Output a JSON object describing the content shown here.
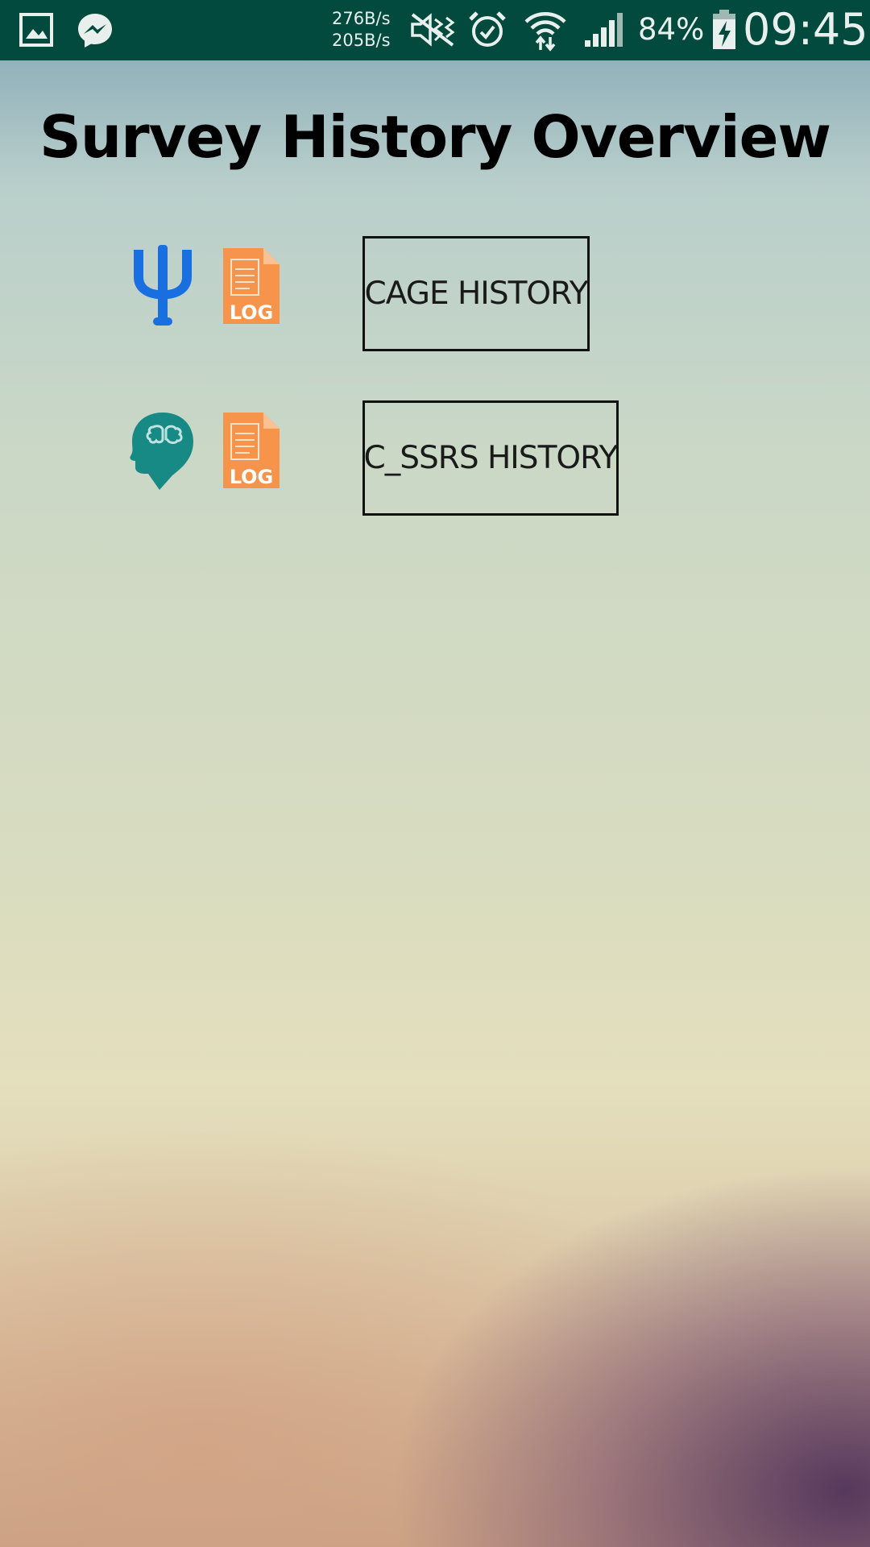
{
  "status_bar": {
    "net_up": "276B/s",
    "net_down": "205B/s",
    "battery_percent": "84%",
    "time": "09:45",
    "icons": [
      "gallery-icon",
      "messenger-icon",
      "mute-icon",
      "alarm-icon",
      "wifi-icon",
      "signal-icon",
      "battery-charging-icon"
    ]
  },
  "page": {
    "title": "Survey History Overview"
  },
  "surveys": [
    {
      "icon": "psi-icon",
      "log_icon": "log-file-icon",
      "log_icon_text": "LOG",
      "button_label": "CAGE HISTORY"
    },
    {
      "icon": "brain-head-icon",
      "log_icon": "log-file-icon",
      "log_icon_text": "LOG",
      "button_label": "C_SSRS HISTORY"
    }
  ],
  "colors": {
    "status_bar": "#024a3e",
    "psi_icon": "#1a6fe0",
    "brain_icon": "#178a86",
    "log_icon": "#f5944a",
    "button_border": "#111111"
  }
}
